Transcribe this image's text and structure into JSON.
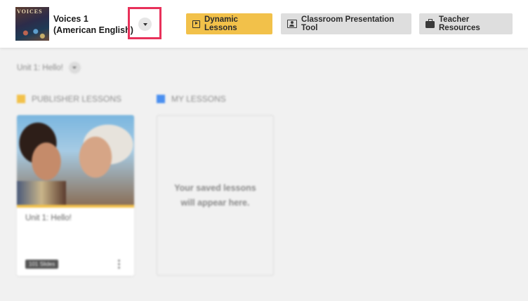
{
  "header": {
    "book": {
      "cover_brand": "VOICES",
      "title_line1": "Voices 1",
      "title_line2": "(American English)"
    },
    "nav": {
      "dynamic_lessons": "Dynamic Lessons",
      "classroom_presentation_tool": "Classroom Presentation Tool",
      "teacher_resources": "Teacher Resources"
    }
  },
  "main": {
    "unit_selector": {
      "label": "Unit 1: Hello!"
    },
    "sections": {
      "publisher": {
        "label": "PUBLISHER LESSONS",
        "color": "#f2c14a"
      },
      "mine": {
        "label": "MY LESSONS",
        "color": "#4a8ff0"
      }
    },
    "publisher_lessons": [
      {
        "title": "Unit 1: Hello!",
        "badge": "101 Slides"
      }
    ],
    "my_lessons_empty": "Your saved lessons will appear here."
  },
  "colors": {
    "accent": "#f2c14a",
    "highlight": "#e8315a",
    "background": "#f1f1f1"
  }
}
